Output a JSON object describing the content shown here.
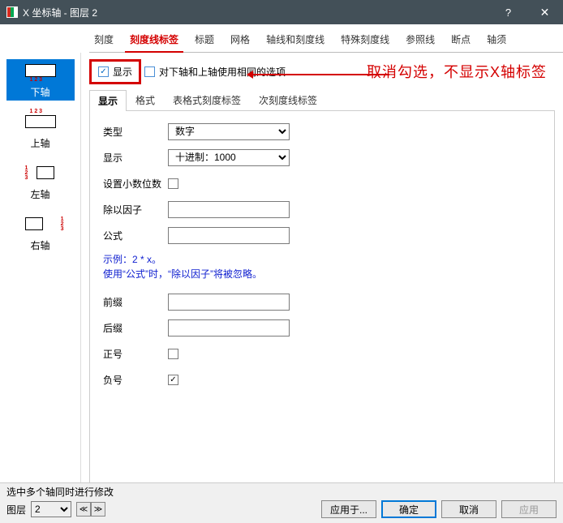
{
  "window": {
    "title": "X 坐标轴 - 图层 2",
    "help": "?",
    "close": "✕"
  },
  "top_tabs": [
    "刻度",
    "刻度线标签",
    "标题",
    "网格",
    "轴线和刻度线",
    "特殊刻度线",
    "参照线",
    "断点",
    "轴须"
  ],
  "top_tabs_active_index": 1,
  "left_nav": [
    {
      "label": "下轴"
    },
    {
      "label": "上轴"
    },
    {
      "label": "左轴"
    },
    {
      "label": "右轴"
    }
  ],
  "left_nav_active_index": 0,
  "checkboxes": {
    "show_label": "显示",
    "show_checked": true,
    "same_opts_label": "对下轴和上轴使用相同的选项",
    "same_opts_checked": false
  },
  "annotation_text": "取消勾选，不显示X轴标签",
  "sub_tabs": [
    "显示",
    "格式",
    "表格式刻度标签",
    "次刻度线标签"
  ],
  "sub_tabs_active_index": 0,
  "form": {
    "type_label": "类型",
    "type_value": "数字",
    "display_label": "显示",
    "display_value": "十进制：1000",
    "decimal_label": "设置小数位数",
    "decimal_checked": false,
    "divide_label": "除以因子",
    "divide_value": "",
    "formula_label": "公式",
    "formula_value": "",
    "hint_line1": "示例：2 * x。",
    "hint_line2": "使用“公式”时，“除以因子”将被忽略。",
    "prefix_label": "前缀",
    "prefix_value": "",
    "suffix_label": "后缀",
    "suffix_value": "",
    "plus_label": "正号",
    "plus_checked": false,
    "minus_label": "负号",
    "minus_checked": true
  },
  "footer": {
    "multi_hint": "选中多个轴同时进行修改",
    "layer_label": "图层",
    "layer_value": "2",
    "apply_to": "应用于...",
    "ok": "确定",
    "cancel": "取消",
    "apply": "应用"
  }
}
